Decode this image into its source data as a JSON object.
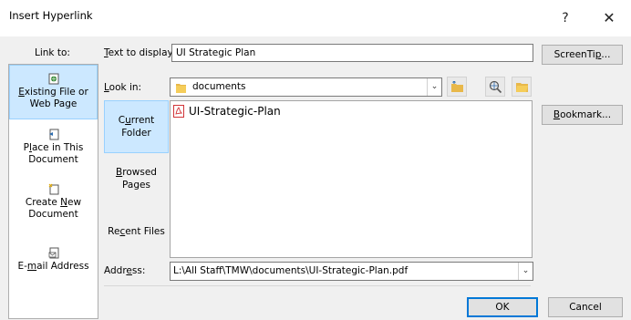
{
  "dialog": {
    "title": "Insert Hyperlink",
    "help_label": "?",
    "close_label": "✕"
  },
  "link_to": {
    "label": "Link to:",
    "items": [
      {
        "label": "Existing File or Web Page",
        "selected": true,
        "icon": "existing-file-web-page-icon"
      },
      {
        "label": "Place in This Document",
        "selected": false,
        "icon": "place-in-document-icon"
      },
      {
        "label": "Create New Document",
        "selected": false,
        "icon": "create-new-document-icon"
      },
      {
        "label": "E-mail Address",
        "selected": false,
        "icon": "email-address-icon"
      }
    ]
  },
  "text_to_display": {
    "label": "Text to display:",
    "value": "UI Strategic Plan"
  },
  "screentip_button": "ScreenTip...",
  "look_in": {
    "label": "Look in:",
    "value": "documents",
    "icon": "folder-icon"
  },
  "toolbar": {
    "up_folder_icon": "up-one-folder-icon",
    "browse_web_icon": "browse-web-icon",
    "browse_file_icon": "browse-file-icon"
  },
  "nav": {
    "items": [
      {
        "label": "Current Folder",
        "selected": true
      },
      {
        "label": "Browsed Pages",
        "selected": false
      },
      {
        "label": "Recent Files",
        "selected": false
      }
    ]
  },
  "files": [
    {
      "name": "UI-Strategic-Plan",
      "icon": "pdf-icon"
    }
  ],
  "bookmark_button": "Bookmark...",
  "address": {
    "label": "Address:",
    "value": "L:\\All Staff\\TMW\\documents\\UI-Strategic-Plan.pdf"
  },
  "ok_button": "OK",
  "cancel_button": "Cancel",
  "colors": {
    "selection": "#cce8ff",
    "selection_border": "#99d1ff",
    "dialog_bg": "#f0f0f0",
    "accent": "#0078d7",
    "pdf_red": "#d13438"
  }
}
